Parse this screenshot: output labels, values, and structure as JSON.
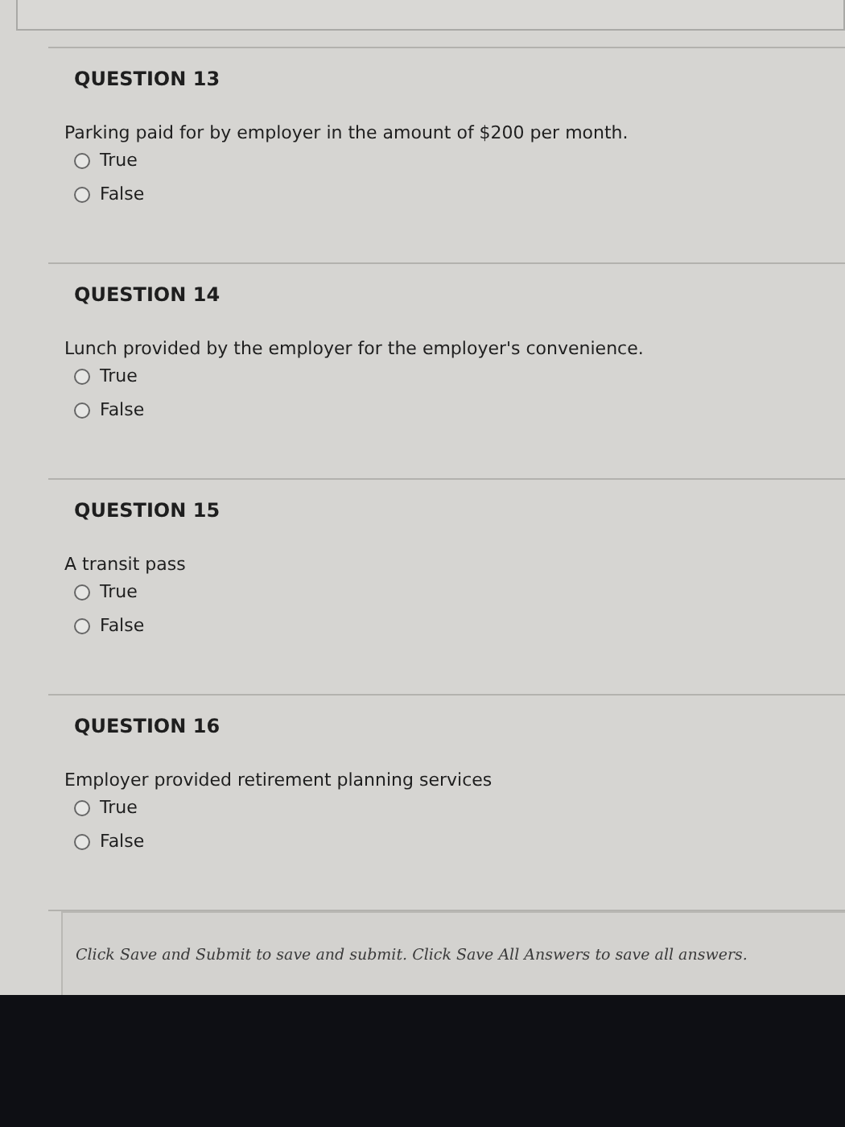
{
  "questions": [
    {
      "heading": "QUESTION 13",
      "prompt": "Parking paid for by employer in the amount of $200 per month.",
      "options": [
        {
          "label": "True",
          "selected": false
        },
        {
          "label": "False",
          "selected": false
        }
      ]
    },
    {
      "heading": "QUESTION 14",
      "prompt": "Lunch provided by the employer for the employer's convenience.",
      "options": [
        {
          "label": "True",
          "selected": false
        },
        {
          "label": "False",
          "selected": false
        }
      ]
    },
    {
      "heading": "QUESTION 15",
      "prompt": "A transit pass",
      "options": [
        {
          "label": "True",
          "selected": false
        },
        {
          "label": "False",
          "selected": false
        }
      ]
    },
    {
      "heading": "QUESTION 16",
      "prompt": "Employer provided retirement planning services",
      "options": [
        {
          "label": "True",
          "selected": false
        },
        {
          "label": "False",
          "selected": false
        }
      ]
    }
  ],
  "footer": {
    "note": "Click Save and Submit to save and submit. Click Save All Answers to save all answers."
  }
}
